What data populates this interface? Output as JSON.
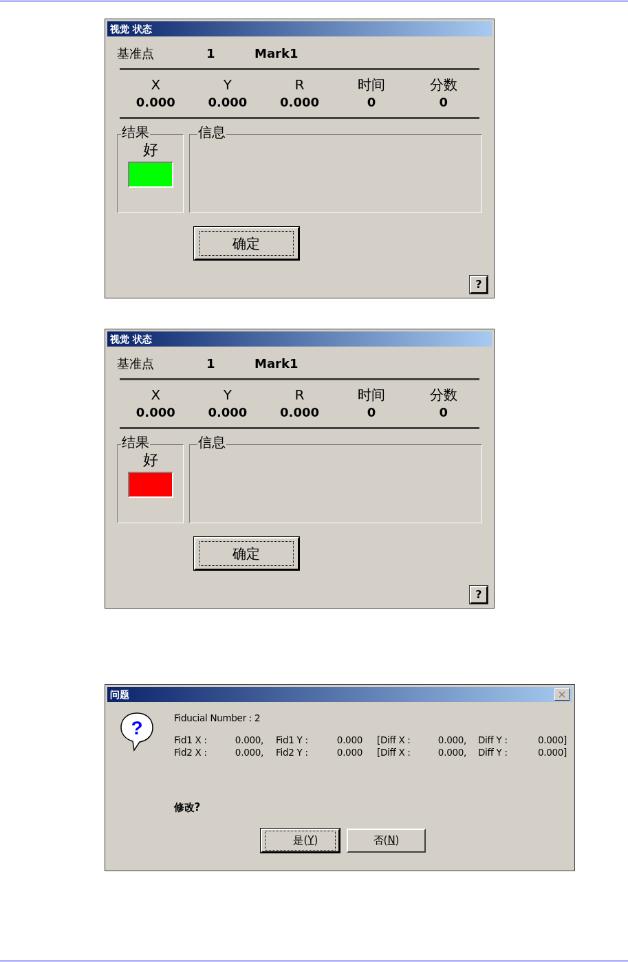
{
  "dialogs": [
    {
      "kind": "vision_status",
      "title": "视觉 状态",
      "fiducial": {
        "label": "基准点",
        "number": "1",
        "name": "Mark1"
      },
      "columns": [
        {
          "header": "X",
          "value": "0.000"
        },
        {
          "header": "Y",
          "value": "0.000"
        },
        {
          "header": "R",
          "value": "0.000"
        },
        {
          "header": "时间",
          "value": "0"
        },
        {
          "header": "分数",
          "value": "0"
        }
      ],
      "result": {
        "label": "结果",
        "text": "好",
        "color": "#00ff00"
      },
      "info": {
        "label": "信息"
      },
      "ok_button": {
        "label": "确定",
        "default": true
      },
      "help_button": "?"
    },
    {
      "kind": "vision_status",
      "title": "视觉 状态",
      "fiducial": {
        "label": "基准点",
        "number": "1",
        "name": "Mark1"
      },
      "columns": [
        {
          "header": "X",
          "value": "0.000"
        },
        {
          "header": "Y",
          "value": "0.000"
        },
        {
          "header": "R",
          "value": "0.000"
        },
        {
          "header": "时间",
          "value": "0"
        },
        {
          "header": "分数",
          "value": "0"
        }
      ],
      "result": {
        "label": "结果",
        "text": "好",
        "color": "#ff0000"
      },
      "info": {
        "label": "信息"
      },
      "ok_button": {
        "label": "确定",
        "default": true
      },
      "help_button": "?"
    },
    {
      "kind": "question",
      "title": "问题",
      "close": "×",
      "icon_glyph": "?",
      "heading": "Fiducial Number : 2",
      "rows": [
        [
          "Fid1 X :",
          "0.000,",
          "Fid1 Y :",
          "0.000",
          "[Diff X :",
          "0.000,",
          "Diff Y :",
          "0.000]"
        ],
        [
          "Fid2 X :",
          "0.000,",
          "Fid2 Y :",
          "0.000",
          "[Diff X :",
          "0.000,",
          "Diff Y :",
          "0.000]"
        ]
      ],
      "prompt": "修改?",
      "buttons": [
        {
          "label": "是(",
          "mnemonic": "Y",
          "label_end": ")",
          "default": true
        },
        {
          "label": "否(",
          "mnemonic": "N",
          "label_end": ")",
          "default": false
        }
      ]
    }
  ]
}
